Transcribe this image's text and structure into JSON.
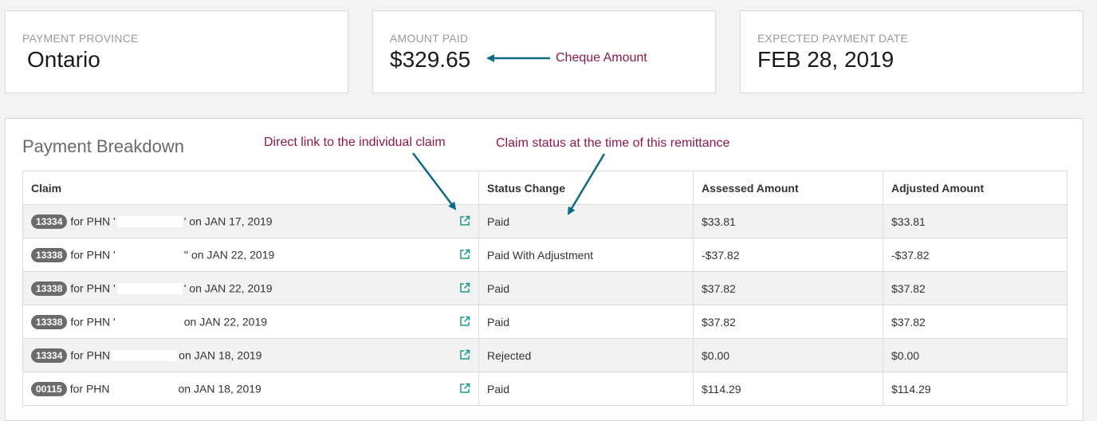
{
  "summary": {
    "province_label": "PAYMENT PROVINCE",
    "province_value": "Ontario",
    "paid_label": "AMOUNT PAID",
    "paid_value": "$329.65",
    "date_label": "EXPECTED PAYMENT DATE",
    "date_value": "FEB 28, 2019"
  },
  "annotations": {
    "cheque": "Cheque Amount",
    "link": "Direct link to the individual claim",
    "status": "Claim status at the time of this remittance"
  },
  "breakdown": {
    "title": "Payment Breakdown",
    "columns": {
      "claim": "Claim",
      "status": "Status Change",
      "assessed": "Assessed Amount",
      "adjusted": "Adjusted Amount"
    },
    "rows": [
      {
        "claim_id": "13334",
        "phn_prefix": "for PHN '",
        "phn_suffix": "' on JAN 17, 2019",
        "status": "Paid",
        "assessed": "$33.81",
        "adjusted": "$33.81"
      },
      {
        "claim_id": "13338",
        "phn_prefix": "for PHN '",
        "phn_suffix": "'' on JAN 22, 2019",
        "status": "Paid With Adjustment",
        "assessed": "-$37.82",
        "adjusted": "-$37.82"
      },
      {
        "claim_id": "13338",
        "phn_prefix": "for PHN '",
        "phn_suffix": "' on JAN 22, 2019",
        "status": "Paid",
        "assessed": "$37.82",
        "adjusted": "$37.82"
      },
      {
        "claim_id": "13338",
        "phn_prefix": "for PHN '",
        "phn_suffix": "on JAN 22, 2019",
        "status": "Paid",
        "assessed": "$37.82",
        "adjusted": "$37.82"
      },
      {
        "claim_id": "13334",
        "phn_prefix": "for PHN",
        "phn_suffix": "on JAN 18, 2019",
        "status": "Rejected",
        "assessed": "$0.00",
        "adjusted": "$0.00"
      },
      {
        "claim_id": "00115",
        "phn_prefix": "for PHN",
        "phn_suffix": "on JAN 18, 2019",
        "status": "Paid",
        "assessed": "$114.29",
        "adjusted": "$114.29"
      }
    ]
  },
  "colors": {
    "annotation_text": "#8c1a4a",
    "arrow": "#0f6a85",
    "link_icon": "#1a9a8c",
    "badge": "#6b6b6b"
  },
  "icons": {
    "claim_link": "external-link-icon"
  }
}
